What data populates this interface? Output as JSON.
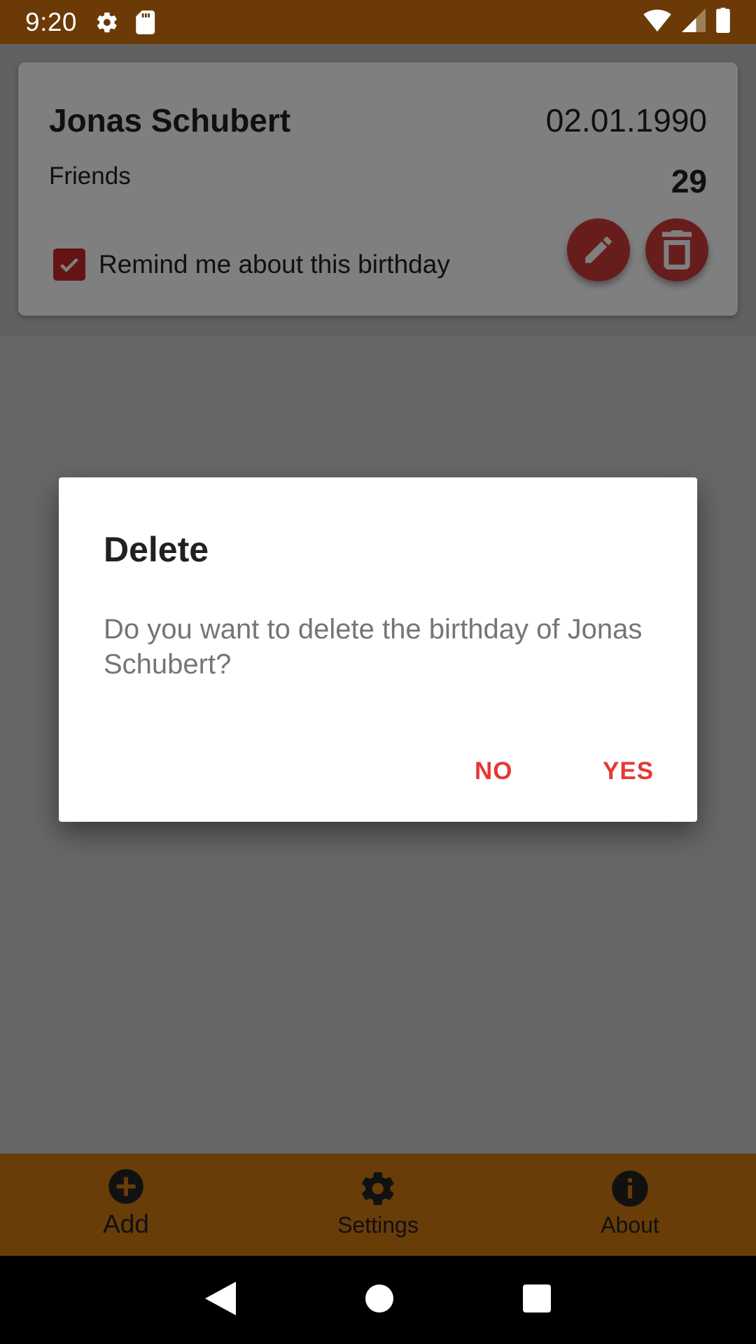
{
  "status_bar": {
    "time": "9:20",
    "icons": [
      "gear-icon",
      "sd-card-icon",
      "wifi-icon",
      "signal-icon",
      "battery-icon"
    ]
  },
  "card": {
    "name": "Jonas Schubert",
    "date": "02.01.1990",
    "group": "Friends",
    "age": "29",
    "remind_label": "Remind me about this birthday",
    "remind_checked": true,
    "accent_color": "#c62828"
  },
  "bottom_nav": {
    "items": [
      {
        "label": "Add",
        "icon": "add-circle-icon"
      },
      {
        "label": "Settings",
        "icon": "gear-icon"
      },
      {
        "label": "About",
        "icon": "info-icon"
      }
    ],
    "background_color": "#d07a11"
  },
  "system_nav": {
    "icons": [
      "back-icon",
      "home-icon",
      "recents-icon"
    ]
  },
  "dialog": {
    "title": "Delete",
    "message": "Do you want to delete the birthday of Jonas Schubert?",
    "no_label": "NO",
    "yes_label": "YES",
    "button_color": "#e53935"
  }
}
